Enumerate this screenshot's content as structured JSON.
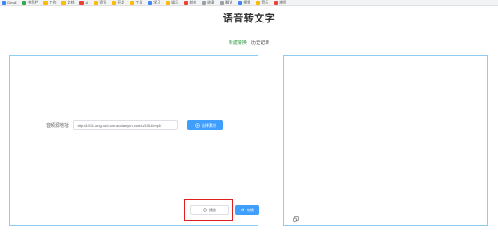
{
  "bookmarks": [
    {
      "label": "Gmail",
      "color": "#4285f4"
    },
    {
      "label": "书签栏",
      "color": "#34a853"
    },
    {
      "label": "工作",
      "color": "#fbbc05"
    },
    {
      "label": "文档",
      "color": "#fbbc05"
    },
    {
      "label": "AI",
      "color": "#ea4335"
    },
    {
      "label": "资讯",
      "color": "#fbbc05"
    },
    {
      "label": "开发",
      "color": "#fbbc05"
    },
    {
      "label": "工具",
      "color": "#fbbc05"
    },
    {
      "label": "学习",
      "color": "#4285f4"
    },
    {
      "label": "娱乐",
      "color": "#fbbc05"
    },
    {
      "label": "其他",
      "color": "#ea4335"
    },
    {
      "label": "收藏",
      "color": "#9aa0a6"
    },
    {
      "label": "翻译",
      "color": "#9aa0a6"
    },
    {
      "label": "视频",
      "color": "#4285f4"
    },
    {
      "label": "音乐",
      "color": "#fbbc05"
    },
    {
      "label": "地图",
      "color": "#ea4335"
    }
  ],
  "page_title": "语音转文字",
  "nav": {
    "active": "新建转换",
    "separator": "|",
    "history": "历史记录"
  },
  "form": {
    "url_label": "音频源地址:",
    "url_value": "http://1011.long-vod.cdn.aodianyun.com/u/1011/mp4/",
    "pick_button": "选择素材",
    "play_button": "播放",
    "convert_button": "转换"
  },
  "icons": {
    "pick": "plus-circle-icon",
    "play": "play-circle-icon",
    "convert": "refresh-icon",
    "copy": "copy-icon"
  },
  "colors": {
    "primary": "#409eff",
    "nav_active": "#2e9a42",
    "panel_border": "#8fcdf0",
    "highlight": "#e02020"
  }
}
